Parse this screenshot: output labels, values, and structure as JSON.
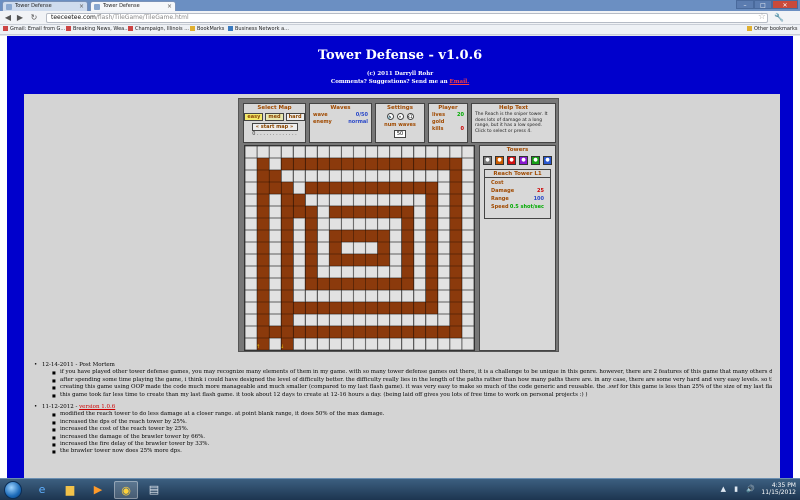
{
  "browser": {
    "tabs": [
      {
        "label": "Tower Defense",
        "active": false
      },
      {
        "label": "Tower Defense",
        "active": true
      }
    ],
    "url_host": "teeceetee.com",
    "url_path": "/flash/TileGame/TileGame.html",
    "bookmarks": [
      "Gmail: Email from G...",
      "Breaking News, Wea...",
      "Champaign, Illinois ...",
      "BookMarks",
      "Business Network a...",
      "Other bookmarks"
    ]
  },
  "page": {
    "title": "Tower Defense - v1.0.6",
    "copyright": "(c) 2011 Darryll Rohr",
    "comments_prefix": "Comments? Suggestions? Send me an",
    "email_link": "Email."
  },
  "game": {
    "select_map": {
      "heading": "Select Map",
      "levels": [
        "easy",
        "med",
        "hard"
      ],
      "start_label": "start map",
      "progress": "0 . . . . . . . . . . . . ."
    },
    "waves": {
      "heading": "Waves",
      "wave_label": "wave",
      "wave_value": "0/50",
      "enemy_label": "enemy",
      "enemy_value": "normal"
    },
    "settings": {
      "heading": "Settings",
      "icons": [
        "🔈",
        "⏸",
        "x1"
      ],
      "num_waves_label": "num waves",
      "num_waves_value": "50"
    },
    "player": {
      "heading": "Player",
      "lives_label": "lives",
      "lives_value": "20",
      "gold_label": "gold",
      "gold_value": "",
      "kills_label": "kills",
      "kills_value": "0"
    },
    "help": {
      "heading": "Help Text",
      "text": "The Reach is the sniper tower. It does lots of damage at a long range, but it has a low speed. Click to select or press 4."
    },
    "towers": {
      "heading": "Towers",
      "icons": [
        {
          "name": "tower-icon-1",
          "color": "#7a7a7a"
        },
        {
          "name": "tower-icon-2",
          "color": "#c85a00"
        },
        {
          "name": "tower-icon-3",
          "color": "#d01010"
        },
        {
          "name": "tower-icon-4",
          "color": "#8a1ad0"
        },
        {
          "name": "tower-icon-5",
          "color": "#18a018"
        },
        {
          "name": "tower-icon-6",
          "color": "#2a58d0"
        }
      ]
    },
    "tower_info": {
      "heading": "Reach Tower L1",
      "cost_label": "Cost",
      "cost_value": "",
      "damage_label": "Damage",
      "damage_value": "25",
      "range_label": "Range",
      "range_value": "100",
      "speed_label": "Speed",
      "speed_value": "0.5 shot/sec"
    },
    "colors": {
      "path": "#8b3a0c",
      "tile": "#e2e2e2",
      "grid": "#9a9a9a"
    }
  },
  "notes": {
    "sections": [
      {
        "heading": "12-14-2011 - Post Mortem",
        "version": "",
        "items": [
          "if you have played other tower defense games, you may recognize many elements of them in my game. with so many tower defense games out there, it is a challenge to be unique in this genre. however, there are 2 features of this game that many others dont have. the first is that there are 48 maps in this game. for fixed pathed maps, few other tower defense games have more than 10 or so maps. the second is that i added selectable AI for the towers. this adds much more strategy to the game.",
          "after spending some time playing the game, i think i could have designed the level of difficulty better. the difficulty really lies in the length of the paths rather than how many paths there are. in any case, there are some very hard and very easy levels. so this game is still fun and challenging.",
          "creating this game using OOP made the code much more manageable and much smaller (compared to my last flash game). it was very easy to make so much of the code generic and reusable. the .swf for this game is less than 25% of the size of my last flash game (which has far less content).",
          "this game took far less time to create than my last flash game. it took about 12 days to create at 12-16 hours a day. (being laid off gives you lots of free time to work on personal projects :) )"
        ]
      },
      {
        "heading": "11-12-2012 - ",
        "version": "version 1.0.6",
        "items": [
          "modified the reach tower to do less damage at a closer range. at point blank range, it does 50% of the max damage.",
          "increased the dps of the reach tower by 25%.",
          "increased the cost of the reach tower by 25%.",
          "increased the damage of the brawler tower by 66%.",
          "increased the fire delay of the brawler tower by 33%.",
          "the brawler tower now does 25% more dps."
        ]
      }
    ]
  },
  "taskbar": {
    "time": "4:35 PM",
    "date": "11/15/2012",
    "apps": [
      "ie-icon",
      "folder-icon",
      "media-icon",
      "chrome-icon",
      "paint-icon"
    ]
  }
}
